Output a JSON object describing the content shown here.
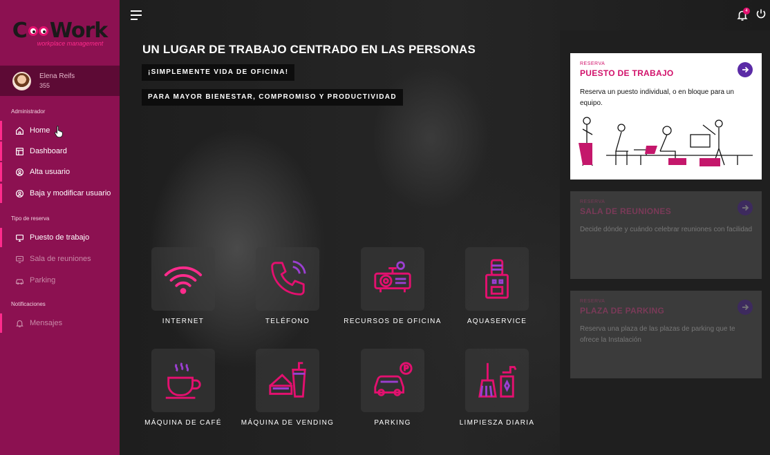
{
  "brand": {
    "logo_left": "C",
    "logo_right": "Work",
    "tagline": "workplace management"
  },
  "user": {
    "name": "Elena Reifs",
    "id": "355"
  },
  "sidebar": {
    "sections": [
      {
        "title": "Administrador"
      },
      {
        "title": "Tipo de reserva"
      },
      {
        "title": "Notificaciones"
      }
    ],
    "items": [
      {
        "label": "Home",
        "icon": "home-icon"
      },
      {
        "label": "Dashboard",
        "icon": "dashboard-icon"
      },
      {
        "label": "Alta usuario",
        "icon": "user-add-icon"
      },
      {
        "label": "Baja y modificar usuario",
        "icon": "user-edit-icon"
      },
      {
        "label": "Puesto de trabajo",
        "icon": "monitor-icon"
      },
      {
        "label": "Sala de reuniones",
        "icon": "meeting-icon"
      },
      {
        "label": "Parking",
        "icon": "car-icon"
      },
      {
        "label": "Mensajes",
        "icon": "bell-icon"
      }
    ]
  },
  "header": {
    "notifications_count": "4"
  },
  "hero": {
    "title": "UN LUGAR DE TRABAJO CENTRADO EN LAS PERSONAS",
    "tag1": "¡SIMPLEMENTE VIDA DE OFICINA!",
    "tag2": "PARA MAYOR BIENESTAR, COMPROMISO Y PRODUCTIVIDAD"
  },
  "services": [
    {
      "label": "INTERNET",
      "icon": "wifi-icon"
    },
    {
      "label": "TELÉFONO",
      "icon": "phone-icon"
    },
    {
      "label": "RECURSOS DE OFICINA",
      "icon": "projector-icon"
    },
    {
      "label": "AQUASERVICE",
      "icon": "water-dispenser-icon"
    },
    {
      "label": "MÁQUINA DE CAFÉ",
      "icon": "coffee-cup-icon"
    },
    {
      "label": "MÁQUINA DE VENDING",
      "icon": "vending-icon"
    },
    {
      "label": "PARKING",
      "icon": "parking-car-icon"
    },
    {
      "label": "LIMPIESZA DIARIA",
      "icon": "cleaning-icon"
    }
  ],
  "reservations": [
    {
      "type": "RESERVA",
      "name": "PUESTO DE TRABAJO",
      "desc": "Reserva un puesto individual, o en bloque para un equipo."
    },
    {
      "type": "RESERVA",
      "name": "SALA DE REUNIONES",
      "desc": "Decide dónde y cuándo celebrar reuniones con facilidad"
    },
    {
      "type": "RESERVA",
      "name": "PLAZA DE PARKING",
      "desc": "Reserva una plaza de las plazas de parking que te ofrece la Instalación"
    }
  ],
  "colors": {
    "sidebar": "#8c1151",
    "accent": "#e3106f",
    "arrow": "#5b2ba6"
  }
}
